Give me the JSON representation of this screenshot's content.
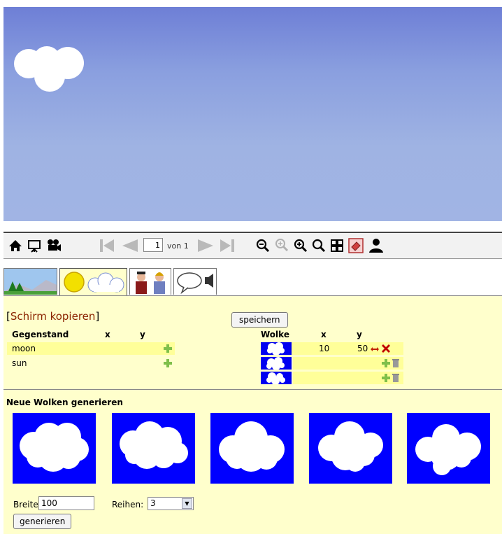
{
  "toolbar": {
    "page_value": "1",
    "page_of": "von 1",
    "icons": [
      "home-icon",
      "presentation-icon",
      "camera-icon",
      "first-page-icon",
      "prev-page-icon",
      "next-page-icon",
      "last-page-icon",
      "zoom-out-icon",
      "zoom-max-icon",
      "zoom-in-icon",
      "zoom-fit-icon",
      "grid-icon",
      "eraser-icon",
      "user-icon"
    ]
  },
  "tabs": [
    "landscape-tab",
    "sky-tab",
    "characters-tab",
    "speech-tab"
  ],
  "panel": {
    "copy_open": "[",
    "copy_label": "Schirm kopieren",
    "copy_close": "]",
    "save_label": "speichern",
    "left_table": {
      "headers": [
        "Gegenstand",
        "x",
        "y"
      ],
      "rows": [
        {
          "name": "moon"
        },
        {
          "name": "sun"
        }
      ]
    },
    "right_table": {
      "headers": [
        "Wolke",
        "x",
        "y"
      ],
      "rows": [
        {
          "x": "10",
          "y": "50"
        },
        {
          "x": "",
          "y": ""
        },
        {
          "x": "",
          "y": ""
        }
      ]
    },
    "generate": {
      "title": "Neue Wolken generieren",
      "width_label": "Breite:",
      "width_value": "100",
      "rows_label": "Reihen:",
      "rows_value": "3",
      "button_label": "generieren"
    }
  },
  "colors": {
    "cloud_bg": "#0000ff",
    "panel_bg": "#ffffcc",
    "link": "#8b2500"
  }
}
